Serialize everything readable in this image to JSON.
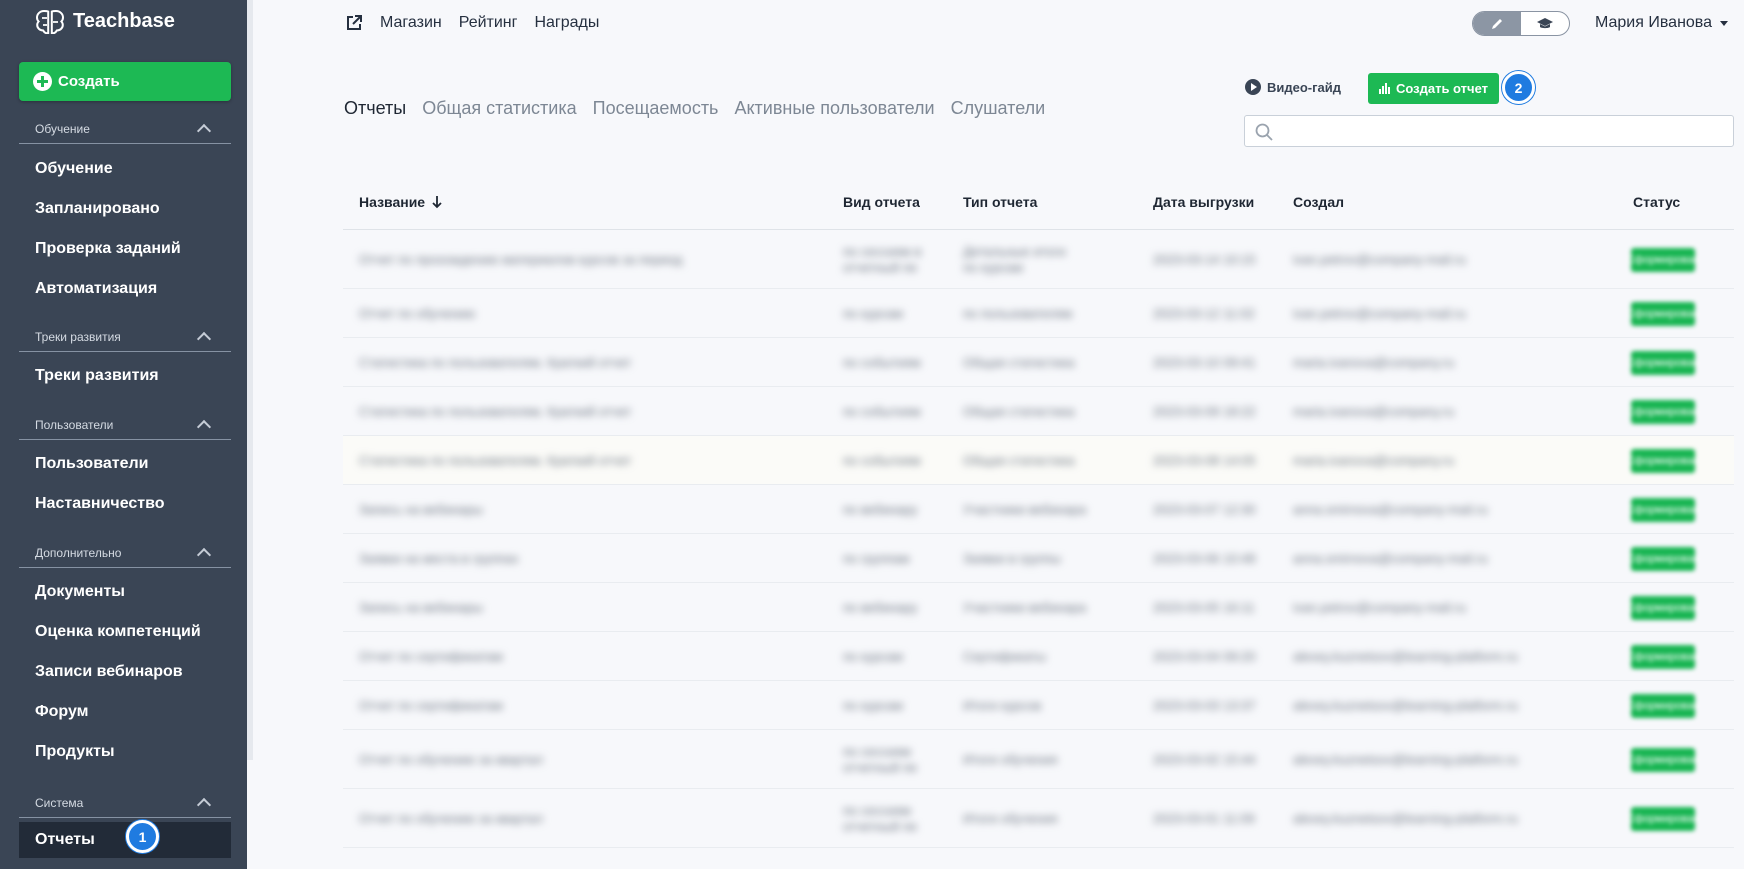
{
  "brand": {
    "name": "Teachbase"
  },
  "sidebar": {
    "create_label": "Создать",
    "sections": [
      {
        "title": "Обучение",
        "items": [
          "Обучение",
          "Запланировано",
          "Проверка заданий",
          "Автоматизация"
        ]
      },
      {
        "title": "Треки развития",
        "items": [
          "Треки развития"
        ]
      },
      {
        "title": "Пользователи",
        "items": [
          "Пользователи",
          "Наставничество"
        ]
      },
      {
        "title": "Дополнительно",
        "items": [
          "Документы",
          "Оценка компетенций",
          "Записи вебинаров",
          "Форум",
          "Продукты"
        ]
      },
      {
        "title": "Система",
        "items": [
          "Отчеты"
        ]
      }
    ],
    "active_item": "Отчеты"
  },
  "topnav": {
    "items": [
      "Магазин",
      "Рейтинг",
      "Награды"
    ]
  },
  "user": {
    "name": "Мария Иванова"
  },
  "tabs": [
    "Отчеты",
    "Общая статистика",
    "Посещаемость",
    "Активные пользователи",
    "Слушатели"
  ],
  "actions": {
    "video_guide": "Видео-гайд",
    "create_report": "Создать отчет"
  },
  "search": {
    "placeholder": "",
    "value": ""
  },
  "table": {
    "headers": {
      "name": "Название",
      "kind": "Вид отчета",
      "type": "Тип отчета",
      "date": "Дата выгрузки",
      "author": "Создал",
      "status": "Статус"
    },
    "rows": [
      {
        "name": "Отчет по прохождению материалов курсов за период",
        "kind": "по сессиям в",
        "kind2": "отчетный пе",
        "type": "Детальные итоги",
        "type2": "по курсам",
        "date": "2023-03-14 10:15",
        "author": "ivan.petrov@company-mail.ru",
        "status": "Сформирован"
      },
      {
        "name": "Отчет по обучению",
        "kind": "по курсам",
        "type": "по пользователям",
        "date": "2023-03-12 11:02",
        "author": "ivan.petrov@company-mail.ru",
        "status": "Сформирован"
      },
      {
        "name": "Статистика по пользователям. Краткий отчет",
        "kind": "по событиям",
        "type": "Общая статистика",
        "date": "2023-03-10 09:41",
        "author": "maria.ivanova@company.ru",
        "status": "Сформирован"
      },
      {
        "name": "Статистика по пользователям. Краткий отчет",
        "kind": "по событиям",
        "type": "Общая статистика",
        "date": "2023-03-09 18:22",
        "author": "maria.ivanova@company.ru",
        "status": "Сформирован"
      },
      {
        "name": "Статистика по пользователям. Краткий отчет",
        "kind": "по событиям",
        "type": "Общая статистика",
        "date": "2023-03-08 14:05",
        "author": "maria.ivanova@company.ru",
        "status": "Сформирован"
      },
      {
        "name": "Запись на вебинары",
        "kind": "по вебинару",
        "type": "Участники вебинара",
        "date": "2023-03-07 12:30",
        "author": "anna.smirnova@company-mail.ru",
        "status": "Сформирован"
      },
      {
        "name": "Заявки на места в группах",
        "kind": "по группам",
        "type": "Заявки в группы",
        "date": "2023-03-06 10:48",
        "author": "anna.smirnova@company-mail.ru",
        "status": "Сформирован"
      },
      {
        "name": "Запись на вебинары",
        "kind": "по вебинару",
        "type": "Участники вебинара",
        "date": "2023-03-05 16:11",
        "author": "ivan.petrov@company-mail.ru",
        "status": "Сформирован"
      },
      {
        "name": "Отчет по сертификатам",
        "kind": "по курсам",
        "type": "Сертификаты",
        "date": "2023-03-04 09:20",
        "author": "alexey.kuznetsov@learning-platform.ru",
        "status": "Сформирован"
      },
      {
        "name": "Отчет по сертификатам",
        "kind": "по курсам",
        "type": "Итоги курсов",
        "date": "2023-03-03 13:37",
        "author": "alexey.kuznetsov@learning-platform.ru",
        "status": "Сформирован"
      },
      {
        "name": "Отчет по обучению за квартал",
        "kind": "по сессиям",
        "kind2": "отчетный пе",
        "type": "Итоги обучения",
        "date": "2023-03-02 15:44",
        "author": "alexey.kuznetsov@learning-platform.ru",
        "status": "Сформирован"
      },
      {
        "name": "Отчет по обучению за квартал",
        "kind": "по сессиям",
        "kind2": "отчетный пе",
        "type": "Итоги обучения",
        "date": "2023-03-01 11:09",
        "author": "alexey.kuznetsov@learning-platform.ru",
        "status": "Сформирован"
      }
    ]
  },
  "annotations": [
    "1",
    "2"
  ],
  "colors": {
    "sidebar_bg": "#3a4555",
    "accent_green": "#1db954",
    "badge_blue": "#1f7be0",
    "page_bg": "#f7f8fb"
  }
}
